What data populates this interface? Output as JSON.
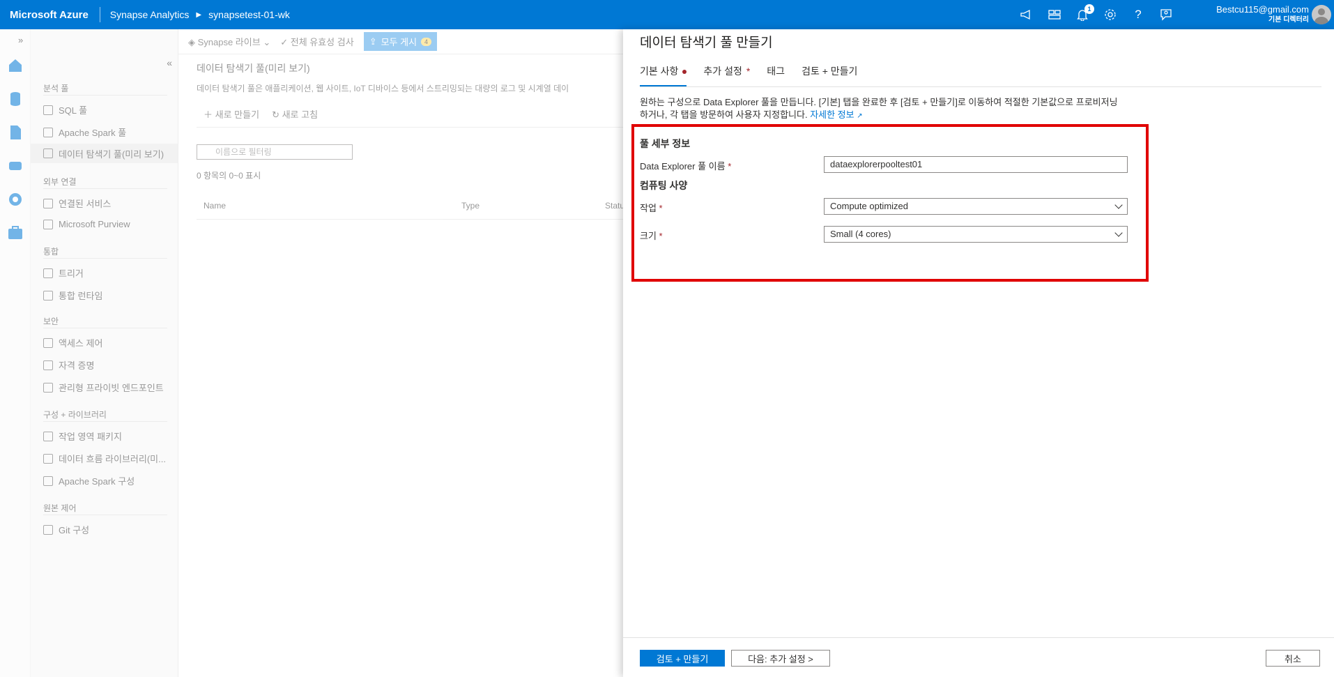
{
  "topbar": {
    "brand": "Microsoft Azure",
    "crumb1": "Synapse Analytics",
    "crumb2": "synapsetest-01-wk",
    "notification_count": "1",
    "account_email": "Bestcu115@gmail.com",
    "account_directory": "기본 디렉터리",
    "icons": [
      "feedback-megaphone-icon",
      "directory-switch-icon",
      "bell-icon",
      "gear-icon",
      "help-icon",
      "feedback-person-icon"
    ]
  },
  "cmdbar": {
    "synapse_live": "Synapse 라이브",
    "validate_all": "전체 유효성 검사",
    "publish_all": "모두 게시",
    "publish_count": "4"
  },
  "sidenav": {
    "sections": [
      {
        "header": "분석 풀",
        "items": [
          "SQL 풀",
          "Apache Spark 풀",
          "데이터 탐색기 풀(미리 보기)"
        ]
      },
      {
        "header": "외부 연결",
        "items": [
          "연결된 서비스",
          "Microsoft Purview"
        ]
      },
      {
        "header": "통합",
        "items": [
          "트리거",
          "통합 런타임"
        ]
      },
      {
        "header": "보안",
        "items": [
          "액세스 제어",
          "자격 증명",
          "관리형 프라이빗 엔드포인트"
        ]
      },
      {
        "header": "구성 + 라이브러리",
        "items": [
          "작업 영역 패키지",
          "데이터 흐름 라이브러리(미...",
          "Apache Spark 구성"
        ]
      },
      {
        "header": "원본 제어",
        "items": [
          "Git 구성"
        ]
      }
    ]
  },
  "main": {
    "title": "데이터 탐색기 풀(미리 보기)",
    "description": "데이터 탐색기 풀은 애플리케이션, 웹 사이트, IoT 디바이스 등에서 스트리밍되는 대량의 로그 및 시계열 데이",
    "new_label": "새로 만들기",
    "refresh_label": "새로 고침",
    "filter_placeholder": "이름으로 필터링",
    "count_text": "0 항목의 0~0 표시",
    "columns": [
      "Name",
      "Type",
      "Statu"
    ]
  },
  "blade": {
    "title": "데이터 탐색기 풀 만들기",
    "tabs": [
      "기본 사항",
      "추가 설정",
      "태그",
      "검토 + 만들기"
    ],
    "intro": "원하는 구성으로 Data Explorer 풀을 만듭니다. [기본] 탭을 완료한 후 [검토 + 만들기]로 이동하여 적절한 기본값으로 프로비저닝하거나, 각 탭을 방문하여 사용자 지정합니다. ",
    "learn_more": "자세한 정보",
    "section_pool": "풀 세부 정보",
    "pool_name_label": "Data Explorer 풀 이름",
    "pool_name_value": "dataexplorerpooltest01",
    "section_compute": "컴퓨팅 사양",
    "workload_label": "작업",
    "workload_value": "Compute optimized",
    "size_label": "크기",
    "size_value": "Small (4 cores)",
    "required_mark": "*",
    "btn_review": "검토 + 만들기",
    "btn_next": "다음: 추가 설정 >",
    "btn_cancel": "취소"
  }
}
